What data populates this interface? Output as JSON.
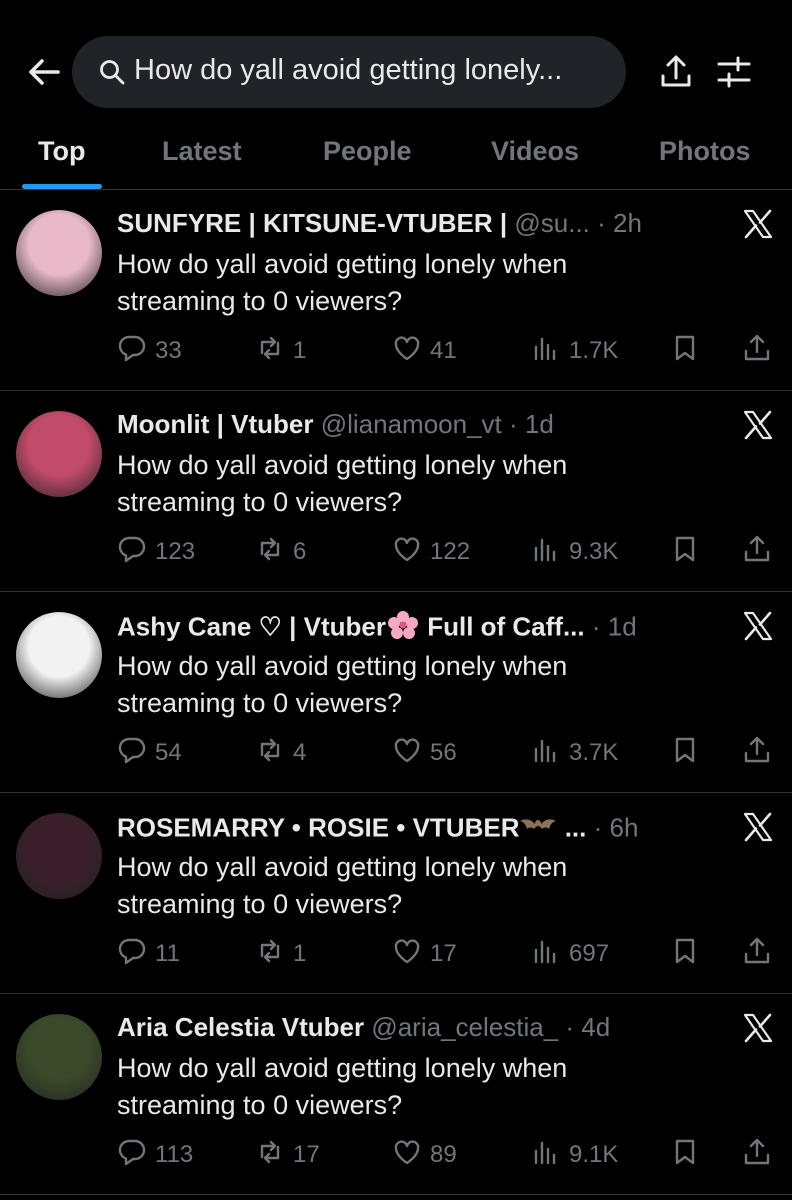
{
  "search": {
    "query": "How do yall avoid getting lonely..."
  },
  "tabs": [
    {
      "label": "Top"
    },
    {
      "label": "Latest"
    },
    {
      "label": "People"
    },
    {
      "label": "Videos"
    },
    {
      "label": "Photos"
    }
  ],
  "posts": [
    {
      "name": "SUNFYRE | KITSUNE-VTUBER |",
      "handle": "@su... · 2h",
      "text": "How do yall avoid getting lonely when streaming to 0 viewers?",
      "replies": "33",
      "reposts": "1",
      "likes": "41",
      "views": "1.7K",
      "avatar_color": "#e8b9c8"
    },
    {
      "name": "Moonlit | Vtuber",
      "handle": "@lianamoon_vt · 1d",
      "text": "How do yall avoid getting lonely when streaming to 0 viewers?",
      "replies": "123",
      "reposts": "6",
      "likes": "122",
      "views": "9.3K",
      "avatar_color": "#c24b6a"
    },
    {
      "name": "Ashy Cane ♡ | Vtuber",
      "name_suffix": " Full of Caff...",
      "handle": "· 1d",
      "text": "How do yall avoid getting lonely when streaming to 0 viewers?",
      "replies": "54",
      "reposts": "4",
      "likes": "56",
      "views": "3.7K",
      "avatar_color": "#f2f2f2"
    },
    {
      "name": "ROSEMARRY • ROSIE • VTUBER",
      "name_suffix": " ...",
      "handle": "· 6h",
      "text": "How do yall avoid getting lonely when streaming to 0 viewers?",
      "replies": "11",
      "reposts": "1",
      "likes": "17",
      "views": "697",
      "avatar_color": "#3a1f2a"
    },
    {
      "name": "Aria Celestia Vtuber",
      "handle": "@aria_celestia_ · 4d",
      "text": "How do yall avoid getting lonely when streaming to 0 viewers?",
      "replies": "113",
      "reposts": "17",
      "likes": "89",
      "views": "9.1K",
      "avatar_color": "#3b4a2a"
    }
  ],
  "colors": {
    "accent": "#1d9bf0",
    "muted": "#71767b",
    "background": "#000000",
    "divider": "#2f3336"
  }
}
